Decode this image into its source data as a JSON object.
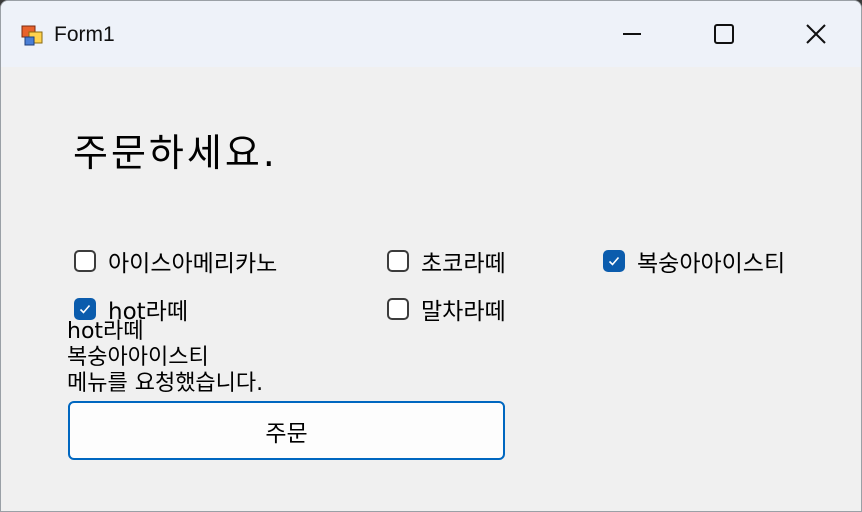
{
  "window": {
    "title": "Form1"
  },
  "heading": "주문하세요.",
  "checkboxes": [
    {
      "label": "아이스아메리카노",
      "checked": false
    },
    {
      "label": "초코라떼",
      "checked": false
    },
    {
      "label": "복숭아아이스티",
      "checked": true
    },
    {
      "label": "hot라떼",
      "checked": true
    },
    {
      "label": "말차라떼",
      "checked": false
    }
  ],
  "result": {
    "line1": "hot라떼",
    "line2": "복숭아아이스티",
    "line3": "메뉴를 요청했습니다."
  },
  "order_button": {
    "label": "주문"
  },
  "colors": {
    "accent": "#0067c0",
    "checked_fill": "#0b5cad",
    "titlebar": "#eef2f9"
  }
}
